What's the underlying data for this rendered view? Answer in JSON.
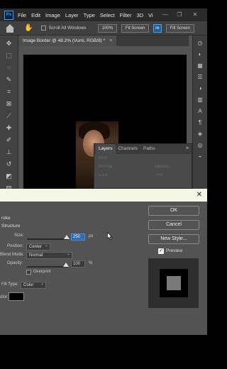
{
  "menu": {
    "logo": "Ps",
    "items": [
      "File",
      "Edit",
      "Image",
      "Layer",
      "Type",
      "Select",
      "Filter",
      "3D",
      "Vi"
    ],
    "controls": [
      "—",
      "❐",
      "✕"
    ]
  },
  "options": {
    "scroll_all": "Scroll All Windows",
    "zoom": "100%",
    "fit_screen": "Fit Screen",
    "fill_screen": "Fill Screen",
    "partial": "re"
  },
  "document": {
    "tab_title": "Image Border @ 48.2% (Vumi, RGB/8) *",
    "close": "×"
  },
  "layers_panel": {
    "tabs": [
      "Layers",
      "Channels",
      "Paths"
    ],
    "search_placeholder": "Kind",
    "blend": "Normal",
    "opacity_label": "Opacity:",
    "lock_label": "Lock:",
    "fill_label": "Fill:"
  },
  "dialog": {
    "title_text": "",
    "section_title": "roke",
    "structure": "Structure",
    "size_label": "Size:",
    "size_value": "250",
    "size_unit": "px",
    "position_label": "Position:",
    "position_value": "Center",
    "blend_mode_label": "Blend Mode:",
    "blend_mode_value": "Normal",
    "opacity_label": "Opacity:",
    "opacity_value": "100",
    "opacity_unit": "%",
    "overprint_label": "Overprint",
    "fill_type_label": "Fill Type:",
    "fill_type_value": "Color",
    "color_label": "olor:",
    "ok": "OK",
    "cancel": "Cancel",
    "new_style": "New Style...",
    "preview_label": "Preview",
    "preview_checked": true,
    "stroke_color": "#000000"
  }
}
